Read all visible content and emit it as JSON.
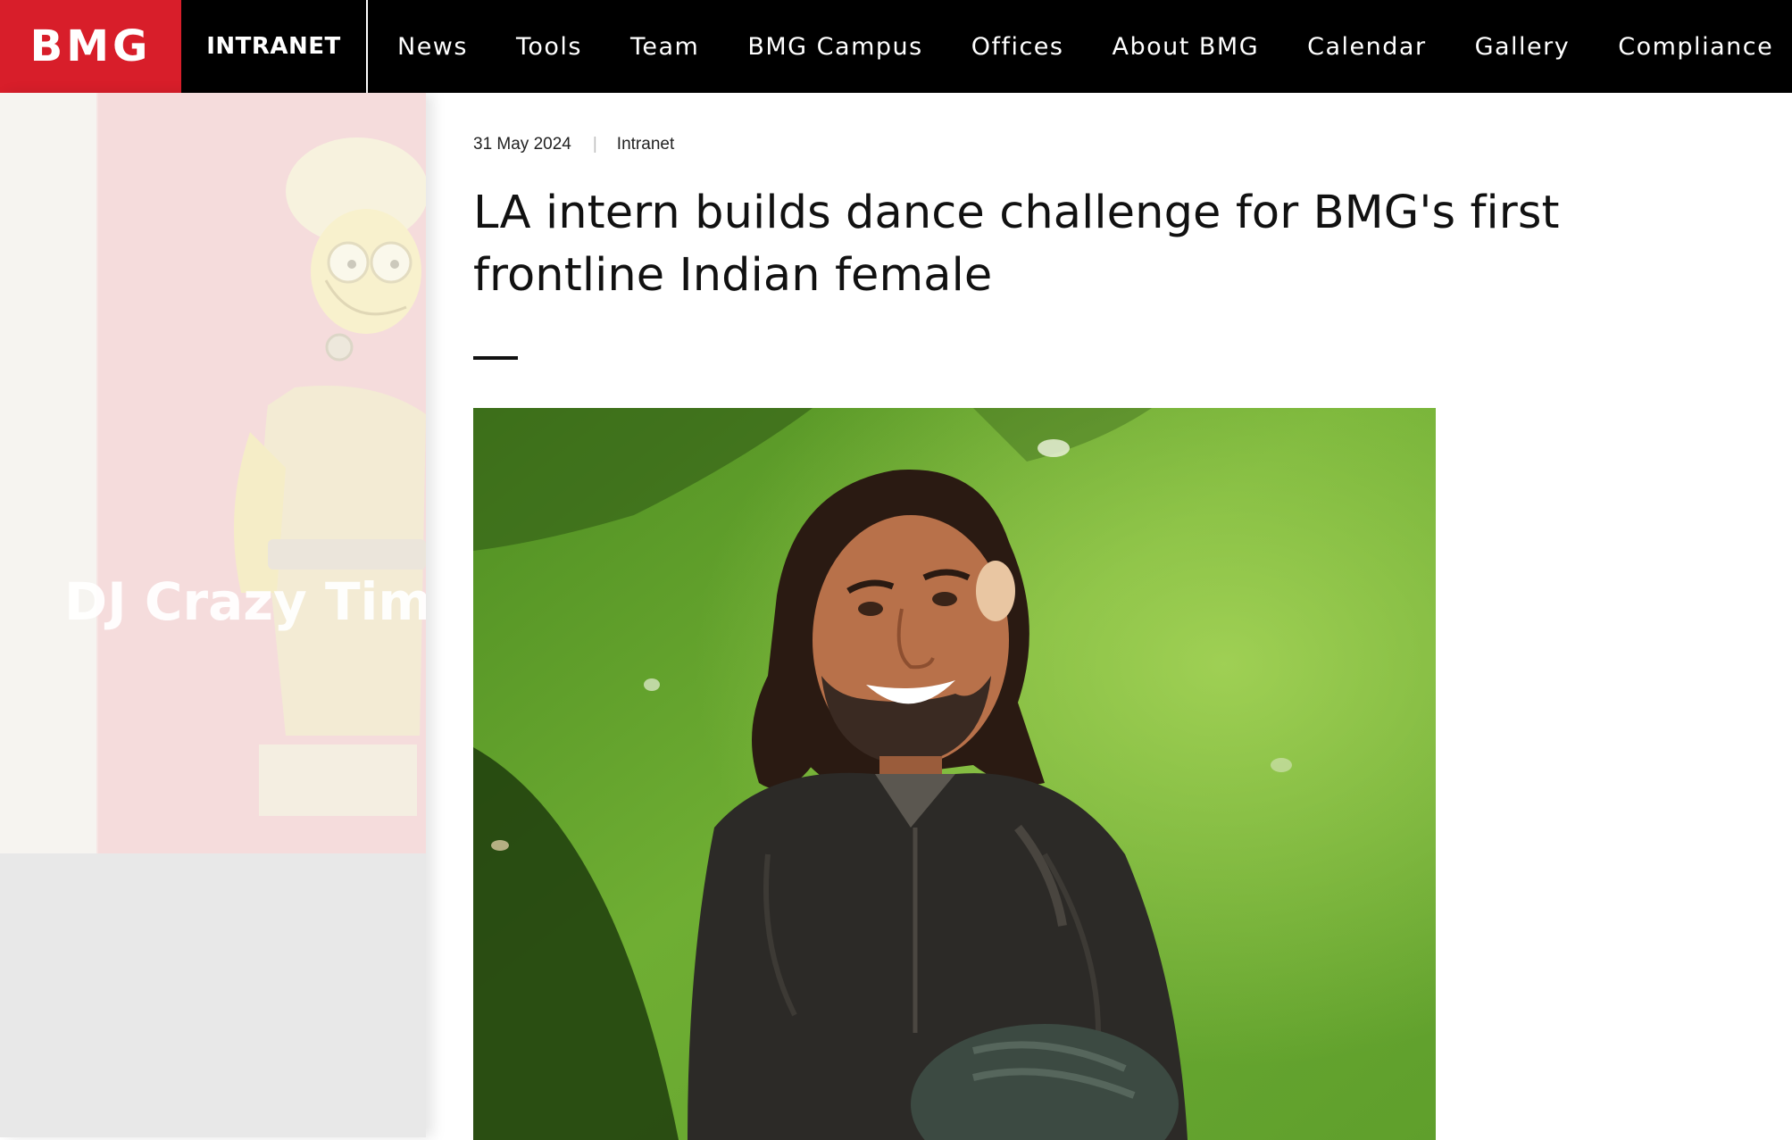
{
  "header": {
    "logo_text": "BMG",
    "section_label": "INTRANET",
    "nav": [
      "News",
      "Tools",
      "Team",
      "BMG Campus",
      "Offices",
      "About BMG",
      "Calendar",
      "Gallery",
      "Compliance"
    ],
    "colors": {
      "logo_bg": "#d81e2a",
      "bar_bg": "#000000",
      "text": "#ffffff"
    }
  },
  "side_promo": {
    "title": "DJ Crazy Time",
    "illustration": "cartoon-character-image"
  },
  "article": {
    "date": "31 May 2024",
    "category": "Intranet",
    "headline": "LA intern builds dance challenge for BMG's first frontline Indian female",
    "hero_image": "smiling-man-on-grass-photo"
  }
}
